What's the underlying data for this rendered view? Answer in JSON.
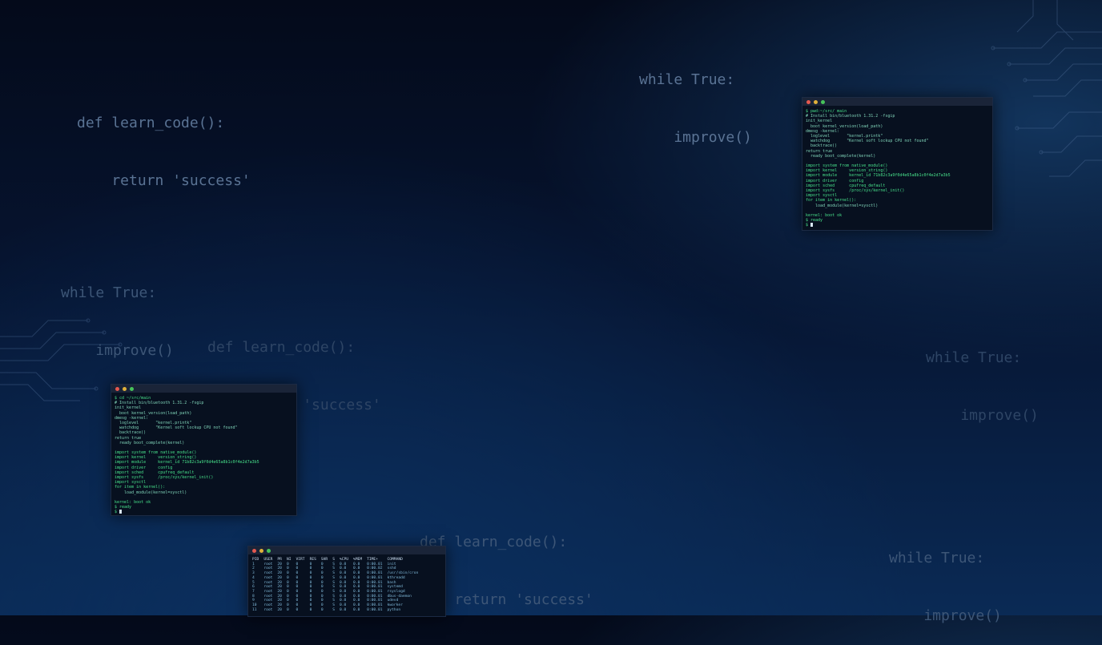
{
  "floating_code": [
    {
      "line1": "def learn_code():",
      "line2": "    return 'success'"
    },
    {
      "line1": "while True:",
      "line2": "    improve()"
    },
    {
      "line1": "while True:",
      "line2": "    improve()"
    },
    {
      "line1": "def learn_code():",
      "line2": "    return 'success'"
    },
    {
      "line1": "while True:",
      "line2": "    improve()"
    },
    {
      "line1": "def learn_code():",
      "line2": "    return 'success'"
    },
    {
      "line1": "while True:",
      "line2": "    improve()"
    }
  ],
  "terminal_right": {
    "lines": [
      "$ pwd:~/src/ main",
      "# Install bin/bluetooth 1.31.2 -fsgip",
      "init_kernel",
      "  boot kernel_version(load_path)",
      "dmesg -kernel:",
      "  loglevel       \"kernel.printk\"",
      "  watchdog       \"Kernel soft lockup CPU not found\"",
      "  backtrace()",
      "return true",
      "  ready boot_complete(kernel)",
      "",
      "import system from native_module()",
      "import kernel     version_string()",
      "import module     kernel_id 71b82c3a9f0d4e65a8b1c0f4e2d7a3b5",
      "import driver     config",
      "import sched      cpufreq_default",
      "import sysfs      /proc/sys/kernel_init()",
      "import sysctl",
      "for item in kernel():",
      "    load_module(kernel=sysctl)",
      "",
      "kernel: boot ok",
      "$ ready",
      "$ "
    ]
  },
  "terminal_left": {
    "lines": [
      "$ cd ~/src/main",
      "# Install bin/bluetooth 1.31.2 -fsgip",
      "init_kernel",
      "  boot kernel_version(load_path)",
      "dmesg -kernel:",
      "  loglevel       \"kernel.printk\"",
      "  watchdog       \"Kernel soft lockup CPU not found\"",
      "  backtrace()",
      "return true",
      "  ready boot_complete(kernel)",
      "",
      "import system from native_module()",
      "import kernel     version_string()",
      "import module     kernel_id 71b82c3a9f0d4e65a8b1c0f4e2d7a3b5",
      "import driver     config",
      "import sched      cpufreq_default",
      "import sysfs      /proc/sys/kernel_init()",
      "import sysctl",
      "for item in kernel():",
      "    load_module(kernel=sysctl)",
      "",
      "kernel: boot ok",
      "$ ready",
      "$ "
    ]
  },
  "terminal_bottom": {
    "headers": [
      "PID",
      "USER",
      "PR",
      "NI",
      "VIRT",
      "RES",
      "SHR",
      "S",
      "%CPU",
      "%MEM",
      "TIME+",
      "COMMAND"
    ],
    "rows": [
      [
        "1",
        "root",
        "20",
        "0",
        "0",
        "0",
        "0",
        "S",
        "0.0",
        "0.0",
        "0:00.01",
        "init"
      ],
      [
        "2",
        "root",
        "20",
        "0",
        "0",
        "0",
        "0",
        "S",
        "0.0",
        "0.0",
        "0:00.02",
        "sshd"
      ],
      [
        "3",
        "root",
        "20",
        "0",
        "0",
        "0",
        "0",
        "S",
        "0.0",
        "0.0",
        "0:00.01",
        "/usr/sbin/cron"
      ],
      [
        "4",
        "root",
        "20",
        "0",
        "0",
        "0",
        "0",
        "S",
        "0.0",
        "0.0",
        "0:00.01",
        "kthreadd"
      ],
      [
        "5",
        "root",
        "20",
        "0",
        "0",
        "0",
        "0",
        "S",
        "0.0",
        "0.0",
        "0:00.01",
        "bash"
      ],
      [
        "6",
        "root",
        "20",
        "0",
        "0",
        "0",
        "0",
        "S",
        "0.0",
        "0.0",
        "0:00.01",
        "systemd"
      ],
      [
        "7",
        "root",
        "20",
        "0",
        "0",
        "0",
        "0",
        "S",
        "0.0",
        "0.0",
        "0:00.01",
        "rsyslogd"
      ],
      [
        "8",
        "root",
        "20",
        "0",
        "0",
        "0",
        "0",
        "S",
        "0.0",
        "0.0",
        "0:00.01",
        "dbus-daemon"
      ],
      [
        "9",
        "root",
        "20",
        "0",
        "0",
        "0",
        "0",
        "S",
        "0.0",
        "0.0",
        "0:00.01",
        "udevd"
      ],
      [
        "10",
        "root",
        "20",
        "0",
        "0",
        "0",
        "0",
        "S",
        "0.0",
        "0.0",
        "0:00.01",
        "kworker"
      ],
      [
        "11",
        "root",
        "20",
        "0",
        "0",
        "0",
        "0",
        "S",
        "0.0",
        "0.0",
        "0:00.01",
        "python"
      ]
    ]
  },
  "colors": {
    "accent": "#47e08a",
    "code": "#5a7394",
    "background": "#061430"
  }
}
